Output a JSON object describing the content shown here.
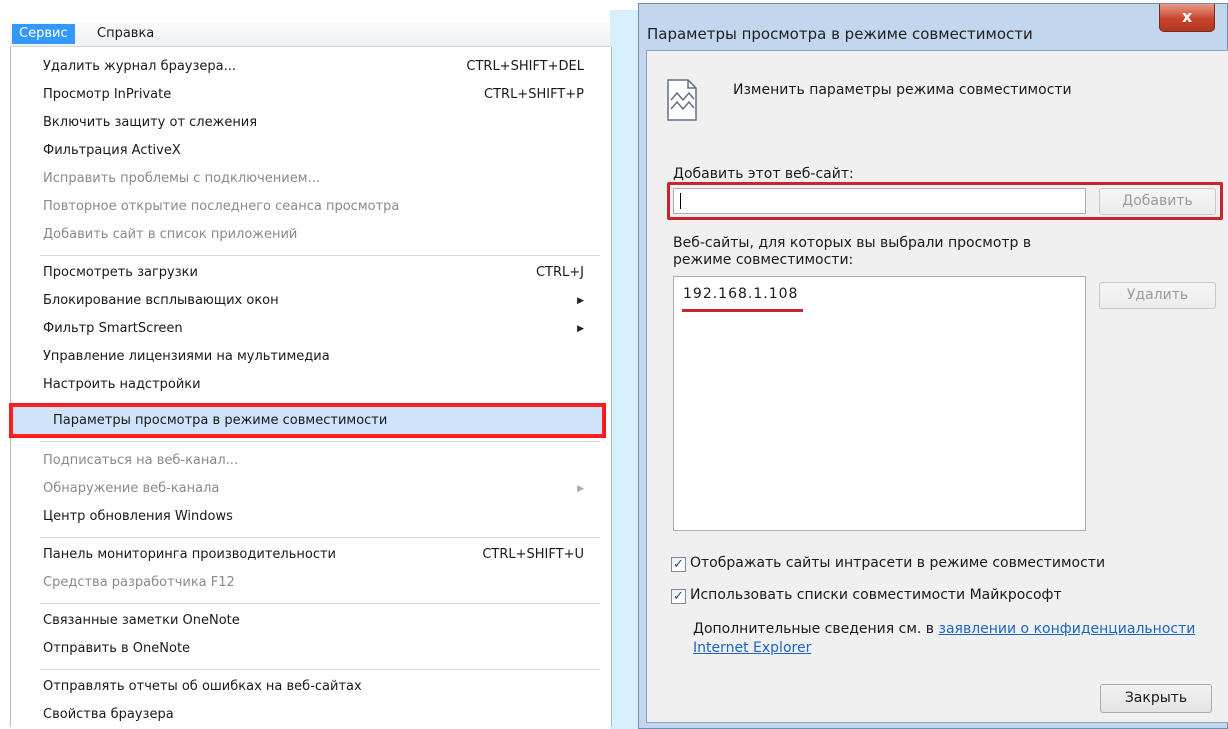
{
  "menubar": {
    "active_menu": "Сервис",
    "second_menu": "Справка"
  },
  "menu": {
    "items": [
      {
        "label": "Удалить журнал браузера...",
        "shortcut": "CTRL+SHIFT+DEL"
      },
      {
        "label": "Просмотр InPrivate",
        "shortcut": "CTRL+SHIFT+P"
      },
      {
        "label": "Включить защиту от слежения"
      },
      {
        "label": "Фильтрация ActiveX"
      },
      {
        "label": "Исправить проблемы с подключением..."
      },
      {
        "label": "Повторное открытие последнего сеанса просмотра"
      },
      {
        "label": "Добавить сайт в список приложений"
      },
      {
        "label": "Просмотреть загрузки",
        "shortcut": "CTRL+J"
      },
      {
        "label": "Блокирование всплывающих окон"
      },
      {
        "label": "Фильтр SmartScreen"
      },
      {
        "label": "Управление лицензиями на мультимедиа"
      },
      {
        "label": "Настроить надстройки"
      },
      {
        "label": "Параметры просмотра в режиме совместимости"
      },
      {
        "label": "Подписаться на веб-канал..."
      },
      {
        "label": "Обнаружение веб-канала"
      },
      {
        "label": "Центр обновления Windows"
      },
      {
        "label": "Панель мониторинга производительности",
        "shortcut": "CTRL+SHIFT+U"
      },
      {
        "label": "Средства разработчика F12"
      },
      {
        "label": "Связанные заметки OneNote"
      },
      {
        "label": "Отправить в OneNote"
      },
      {
        "label": "Отправлять отчеты об ошибках на веб-сайтах"
      },
      {
        "label": "Свойства браузера"
      }
    ]
  },
  "dialog": {
    "title": "Параметры просмотра в режиме совместимости",
    "close_symbol": "x",
    "heading": "Изменить параметры режима совместимости",
    "add_label": "Добавить этот веб-сайт:",
    "add_value": "",
    "add_button": "Добавить",
    "list_label_line1": "Веб-сайты, для которых вы выбрали просмотр в",
    "list_label_line2": "режиме совместимости:",
    "sites": [
      "192.168.1.108"
    ],
    "remove_button": "Удалить",
    "checkbox1": {
      "label": "Отображать сайты интрасети в режиме совместимости",
      "checked": true
    },
    "checkbox2": {
      "label": "Использовать списки совместимости Майкрософт",
      "checked": true
    },
    "info_prefix": "Дополнительные сведения см. в ",
    "info_link_part1": "заявлении о конфиденциальности",
    "info_link_part2": "Internet Explorer",
    "close_button": "Закрыть"
  },
  "colors": {
    "highlight_border": "#ff2020",
    "annotation_red": "#c8262e",
    "menu_active": "#3399ff",
    "link": "#1a66c5",
    "callout": "#cfeefc"
  }
}
